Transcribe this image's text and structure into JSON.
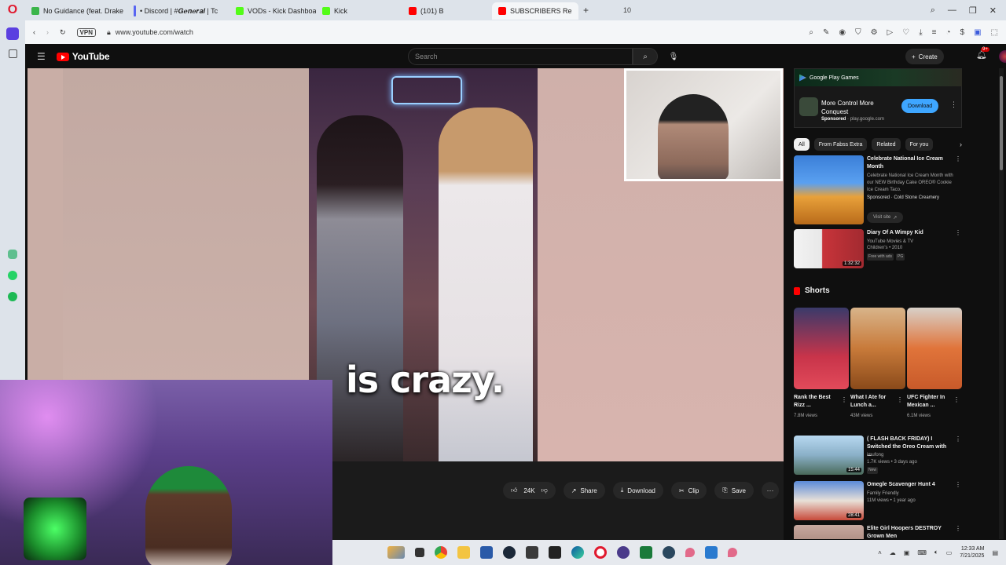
{
  "browser": {
    "tabs": [
      {
        "label": "No Guidance (feat. Drake",
        "color": "#3bb54a"
      },
      {
        "label": "• Discord | #𝑮𝒆𝒏𝒆𝒓𝒂𝒍 | Tc",
        "color": "#5865f2"
      },
      {
        "label": "VODs - Kick Dashboard",
        "color": "#53fc18"
      },
      {
        "label": "Kick",
        "color": "#53fc18"
      },
      {
        "label": "(101) B",
        "color": "#ff0000"
      },
      {
        "label": "SUBSCRIBERS Re",
        "color": "#ff0000"
      }
    ],
    "tab_count": "10",
    "new_tab": "+",
    "vpn": "VPN",
    "url": "www.youtube.com/watch"
  },
  "youtube": {
    "logo_text": "YouTube",
    "search_placeholder": "Search",
    "create_label": "Create",
    "notif_badge": "9+"
  },
  "video": {
    "caption": "is crazy."
  },
  "actions": {
    "likes": "24K",
    "share": "Share",
    "download": "Download",
    "clip": "Clip",
    "save": "Save"
  },
  "ad": {
    "brand": "Google Play Games",
    "title": "More Control More Conquest",
    "sponsored": "Sponsored",
    "domain": "play.google.com",
    "cta": "Download"
  },
  "chips": [
    "All",
    "From Fabss Extra",
    "Related",
    "For you"
  ],
  "recs_top": [
    {
      "title": "Celebrate National Ice Cream Month",
      "desc": "Celebrate National Ice Cream Month with our NEW Birthday Cake OREO® Cookie Ice Cream Taco.",
      "channel": "Sponsored · Cold Stone Creamery",
      "visit": "Visit site"
    },
    {
      "title": "Diary Of A Wimpy Kid",
      "channel": "YouTube Movies & TV",
      "meta": "Children's • 2010",
      "tag1": "Free with ads",
      "tag2": "PG",
      "duration": "1:32:32"
    }
  ],
  "shorts": {
    "heading": "Shorts",
    "items": [
      {
        "title": "Rank the Best Rizz ...",
        "views": "7.8M views"
      },
      {
        "title": "What I Ate for Lunch a...",
        "views": "43M views"
      },
      {
        "title": "UFC Fighter In Mexican ...",
        "views": "6.1M views"
      }
    ]
  },
  "recs_bottom": [
    {
      "title": "( FLASH BACK FRIDAY) I Switched the Oreo Cream with ...",
      "channel": "imufong",
      "meta": "1.7K views • 3 days ago",
      "tag": "New",
      "duration": "15:44"
    },
    {
      "title": "Omegle Scavenger Hunt 4",
      "channel": "Family Friendly",
      "meta": "11M views • 1 year ago",
      "duration": "28:41"
    },
    {
      "title": "Elite Girl Hoopers DESTROY Grown Men",
      "channel": "",
      "meta": ""
    }
  ],
  "taskbar": {
    "time": "12:33 AM",
    "date": "7/21/2025"
  }
}
